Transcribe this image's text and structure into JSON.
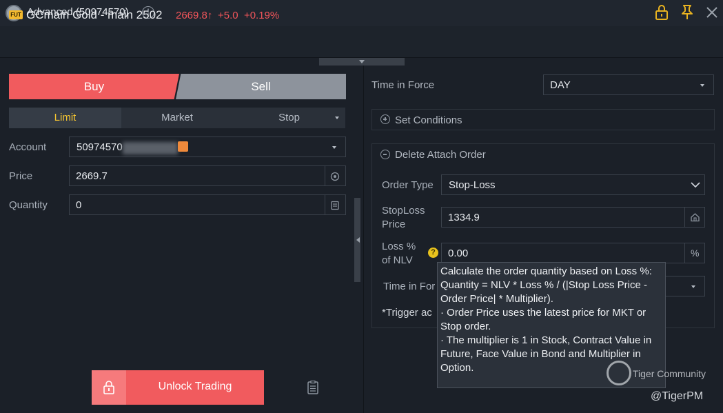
{
  "window": {
    "title": "Advanced (50974570)",
    "icons": [
      "app-logo-icon",
      "info-icon",
      "lock-icon",
      "pin-icon",
      "close-icon"
    ]
  },
  "instrument": {
    "badge": "FUT",
    "name": "GCmain Gold - main 2502",
    "price": "2669.8↑",
    "change": "+5.0  +0.19%",
    "color_up": "#f1555a"
  },
  "order": {
    "buy_label": "Buy",
    "sell_label": "Sell",
    "tabs": [
      "Limit",
      "Market",
      "Stop"
    ],
    "account_label": "Account",
    "account_value": "50974570",
    "price_label": "Price",
    "price_value": "2669.7",
    "quantity_label": "Quantity",
    "quantity_value": "0",
    "unlock_label": "Unlock Trading"
  },
  "right": {
    "tif_label": "Time in Force",
    "tif_value": "DAY",
    "set_conditions": "Set Conditions",
    "delete_attach": "Delete Attach Order",
    "order_type_label": "Order Type",
    "order_type_value": "Stop-Loss",
    "stoploss_label_1": "StopLoss",
    "stoploss_label_2": "Price",
    "stoploss_value": "1334.9",
    "loss_label_1": "Loss %",
    "loss_label_2": "of NLV",
    "loss_value": "0.00",
    "loss_unit": "%",
    "help": "?",
    "tif2_label": "Time in For",
    "trigger_text": "*Trigger ac"
  },
  "tooltip": {
    "text": "Calculate the order quantity based on Loss %:\nQuantity = NLV * Loss % / (|Stop Loss Price - Order Price| * Multiplier).\n· Order Price uses the latest price for MKT or Stop order.\n· The multiplier is 1 in Stock, Contract Value in Future, Face Value in Bond and Multiplier in Option."
  },
  "watermark": {
    "brand": "Tiger Community",
    "user": "@TigerPM"
  },
  "colors": {
    "buy": "#f15b5e",
    "sell": "#8d939c",
    "active_tab": "#f4c431"
  }
}
